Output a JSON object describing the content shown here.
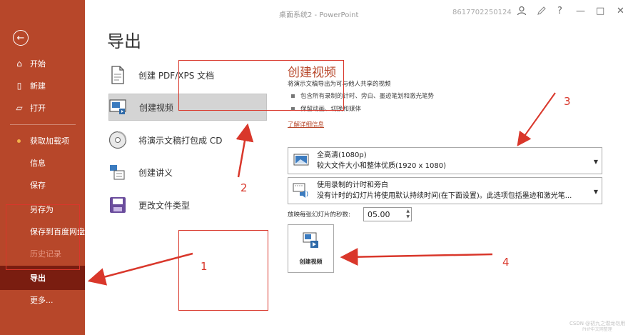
{
  "titlebar": {
    "doc_title": "桌面系统2 - PowerPoint",
    "account": "8617702250124",
    "icons": [
      "user-icon",
      "pen-icon",
      "help-icon",
      "minimize-icon",
      "restore-icon",
      "close-icon"
    ],
    "help_glyph": "?",
    "minimize_glyph": "—",
    "restore_glyph": "□",
    "close_glyph": "✕"
  },
  "sidebar": {
    "back_glyph": "←",
    "items": [
      {
        "label": "开始",
        "icon": "home-icon",
        "glyph": "⌂"
      },
      {
        "label": "新建",
        "icon": "new-document-icon",
        "glyph": "▯"
      },
      {
        "label": "打开",
        "icon": "open-folder-icon",
        "glyph": "▱"
      },
      {
        "label": "获取加载项"
      },
      {
        "label": "信息"
      },
      {
        "label": "保存"
      },
      {
        "label": "另存为"
      },
      {
        "label": "保存到百度网盘"
      },
      {
        "label": "历史记录"
      },
      {
        "label": "导出"
      },
      {
        "label": "更多..."
      }
    ],
    "active_index": 9
  },
  "main": {
    "title": "导出",
    "options": [
      {
        "label": "创建 PDF/XPS 文档",
        "icon": "pdf-document-icon"
      },
      {
        "label": "创建视频",
        "icon": "video-icon"
      },
      {
        "label": "将演示文稿打包成 CD",
        "icon": "cd-icon"
      },
      {
        "label": "创建讲义",
        "icon": "handout-icon"
      },
      {
        "label": "更改文件类型",
        "icon": "file-type-icon"
      }
    ],
    "selected_option": 1
  },
  "detail": {
    "title": "创建视频",
    "description": "将演示文稿导出为可与他人共享的视频",
    "bullets": [
      "包含所有录制的计时、旁白、墨迹笔划和激光笔势",
      "保留动画、切换和媒体"
    ],
    "link": "了解详细信息",
    "quality": {
      "title": "全高清(1080p)",
      "subtitle": "较大文件大小和整体优质(1920 x 1080)"
    },
    "timing": {
      "title": "使用录制的计时和旁白",
      "subtitle": "没有计时的幻灯片将使用默认持续时间(在下面设置)。此选项包括墨迹和激光笔..."
    },
    "seconds_label": "放映每张幻灯片的秒数:",
    "seconds_value": "05.00",
    "create_button": "创建视频",
    "caret_glyph": "▼",
    "spin_up": "▲",
    "spin_down": "▼"
  },
  "annotations": {
    "numbers": [
      "1",
      "2",
      "3",
      "4"
    ],
    "color": "#d9372b"
  },
  "watermark": {
    "line1": "CSDN @初九之潜龙勿用",
    "line2": "PHP中文网整理"
  },
  "colors": {
    "sidebar": "#b7472a",
    "sidebar_active": "#7a1d10",
    "accent": "#b7472a"
  }
}
